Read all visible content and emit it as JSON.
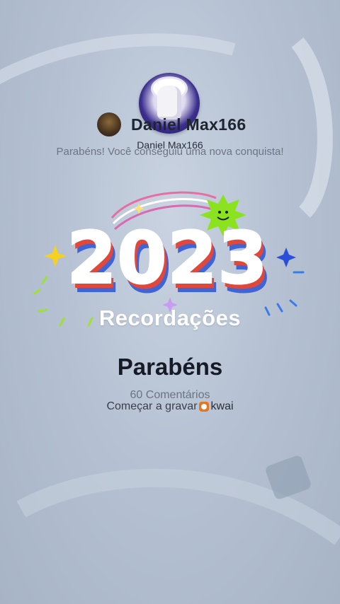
{
  "profile": {
    "main_avatar_name": "Daniel Max166",
    "header_user_name": "Daniel Max166"
  },
  "achievement": {
    "message": "Parabéns! Você conseguiu uma nova conquista!",
    "year": "2023",
    "label": "Recordações"
  },
  "post": {
    "title": "Parabéns",
    "comments": "60 Comentários",
    "record_label": "Começar a gravar",
    "app_name": "kwai"
  },
  "colors": {
    "year_red": "#e0483c",
    "year_blue": "#3f64d6",
    "year_yellow": "#f4c23a",
    "star_green": "#8be31f",
    "kwai_orange": "#e8751a"
  }
}
